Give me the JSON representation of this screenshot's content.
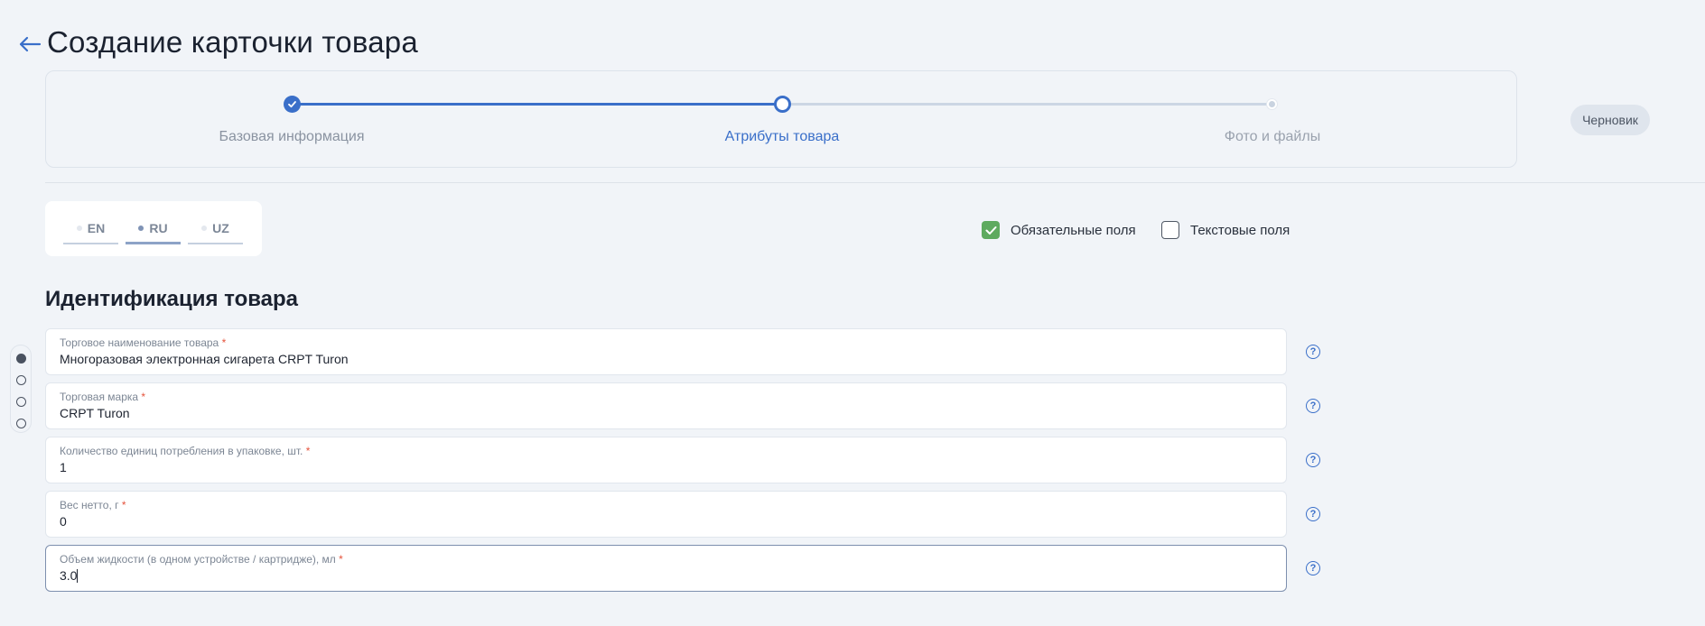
{
  "header": {
    "title": "Создание карточки товара"
  },
  "stepper": {
    "steps": [
      {
        "label": "Базовая информация",
        "state": "done"
      },
      {
        "label": "Атрибуты товара",
        "state": "active"
      },
      {
        "label": "Фото и файлы",
        "state": "todo"
      }
    ],
    "status_badge": "Черновик"
  },
  "languages": {
    "items": [
      "EN",
      "RU",
      "UZ"
    ],
    "selected": "RU"
  },
  "filters": {
    "required_fields": {
      "label": "Обязательные поля",
      "checked": true
    },
    "text_fields": {
      "label": "Текстовые поля",
      "checked": false
    }
  },
  "section": {
    "title": "Идентификация товара"
  },
  "side_nav": {
    "count": 4,
    "active_index": 0
  },
  "fields": [
    {
      "label": "Торговое наименование товара",
      "required_mark": "*",
      "value": "Многоразовая электронная сигарета CRPT Turon"
    },
    {
      "label": "Торговая марка",
      "required_mark": "*",
      "value": "CRPT Turon"
    },
    {
      "label": "Количество единиц потребления в упаковке, шт.",
      "required_mark": "*",
      "value": "1"
    },
    {
      "label": "Вес нетто, г",
      "required_mark": "*",
      "value": "0"
    },
    {
      "label": "Объем жидкости (в одном устройстве / картридже), мл",
      "required_mark": "*",
      "value": "3.0"
    }
  ],
  "help_icon_glyph": "?",
  "colors": {
    "accent": "#3a6fc9",
    "checkbox_on": "#5eaa5f",
    "required": "#e5533c"
  }
}
